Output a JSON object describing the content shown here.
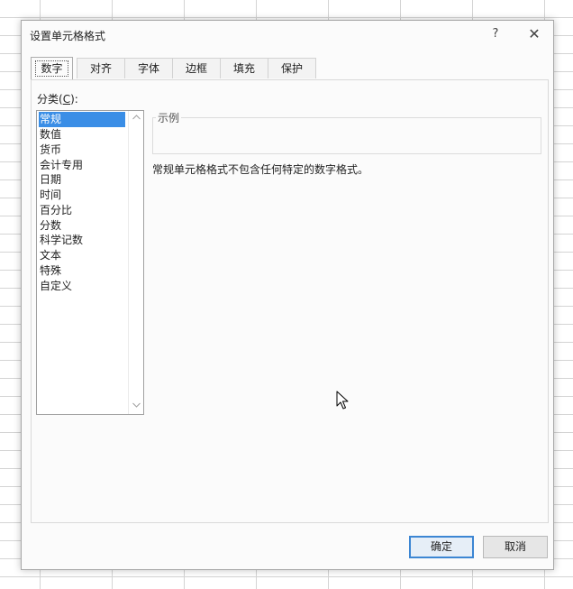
{
  "dialog": {
    "title": "设置单元格格式",
    "help_label": "?",
    "close_label": "✕"
  },
  "tabs": [
    {
      "label": "数字",
      "active": true
    },
    {
      "label": "对齐",
      "active": false
    },
    {
      "label": "字体",
      "active": false
    },
    {
      "label": "边框",
      "active": false
    },
    {
      "label": "填充",
      "active": false
    },
    {
      "label": "保护",
      "active": false
    }
  ],
  "category": {
    "label_prefix": "分类(",
    "label_accel": "C",
    "label_suffix": "):",
    "items": [
      "常规",
      "数值",
      "货币",
      "会计专用",
      "日期",
      "时间",
      "百分比",
      "分数",
      "科学记数",
      "文本",
      "特殊",
      "自定义"
    ],
    "selected": "常规"
  },
  "sample": {
    "legend": "示例",
    "value": ""
  },
  "description": "常规单元格格式不包含任何特定的数字格式。",
  "buttons": {
    "ok": "确定",
    "cancel": "取消"
  },
  "colors": {
    "selection": "#3a8ee6",
    "ok_border": "#3c86d3",
    "cell_selection": "#4c8a52"
  },
  "icons": {
    "scroll_up": "chevron-up-icon",
    "scroll_down": "chevron-down-icon",
    "cursor": "mouse-pointer-icon"
  }
}
